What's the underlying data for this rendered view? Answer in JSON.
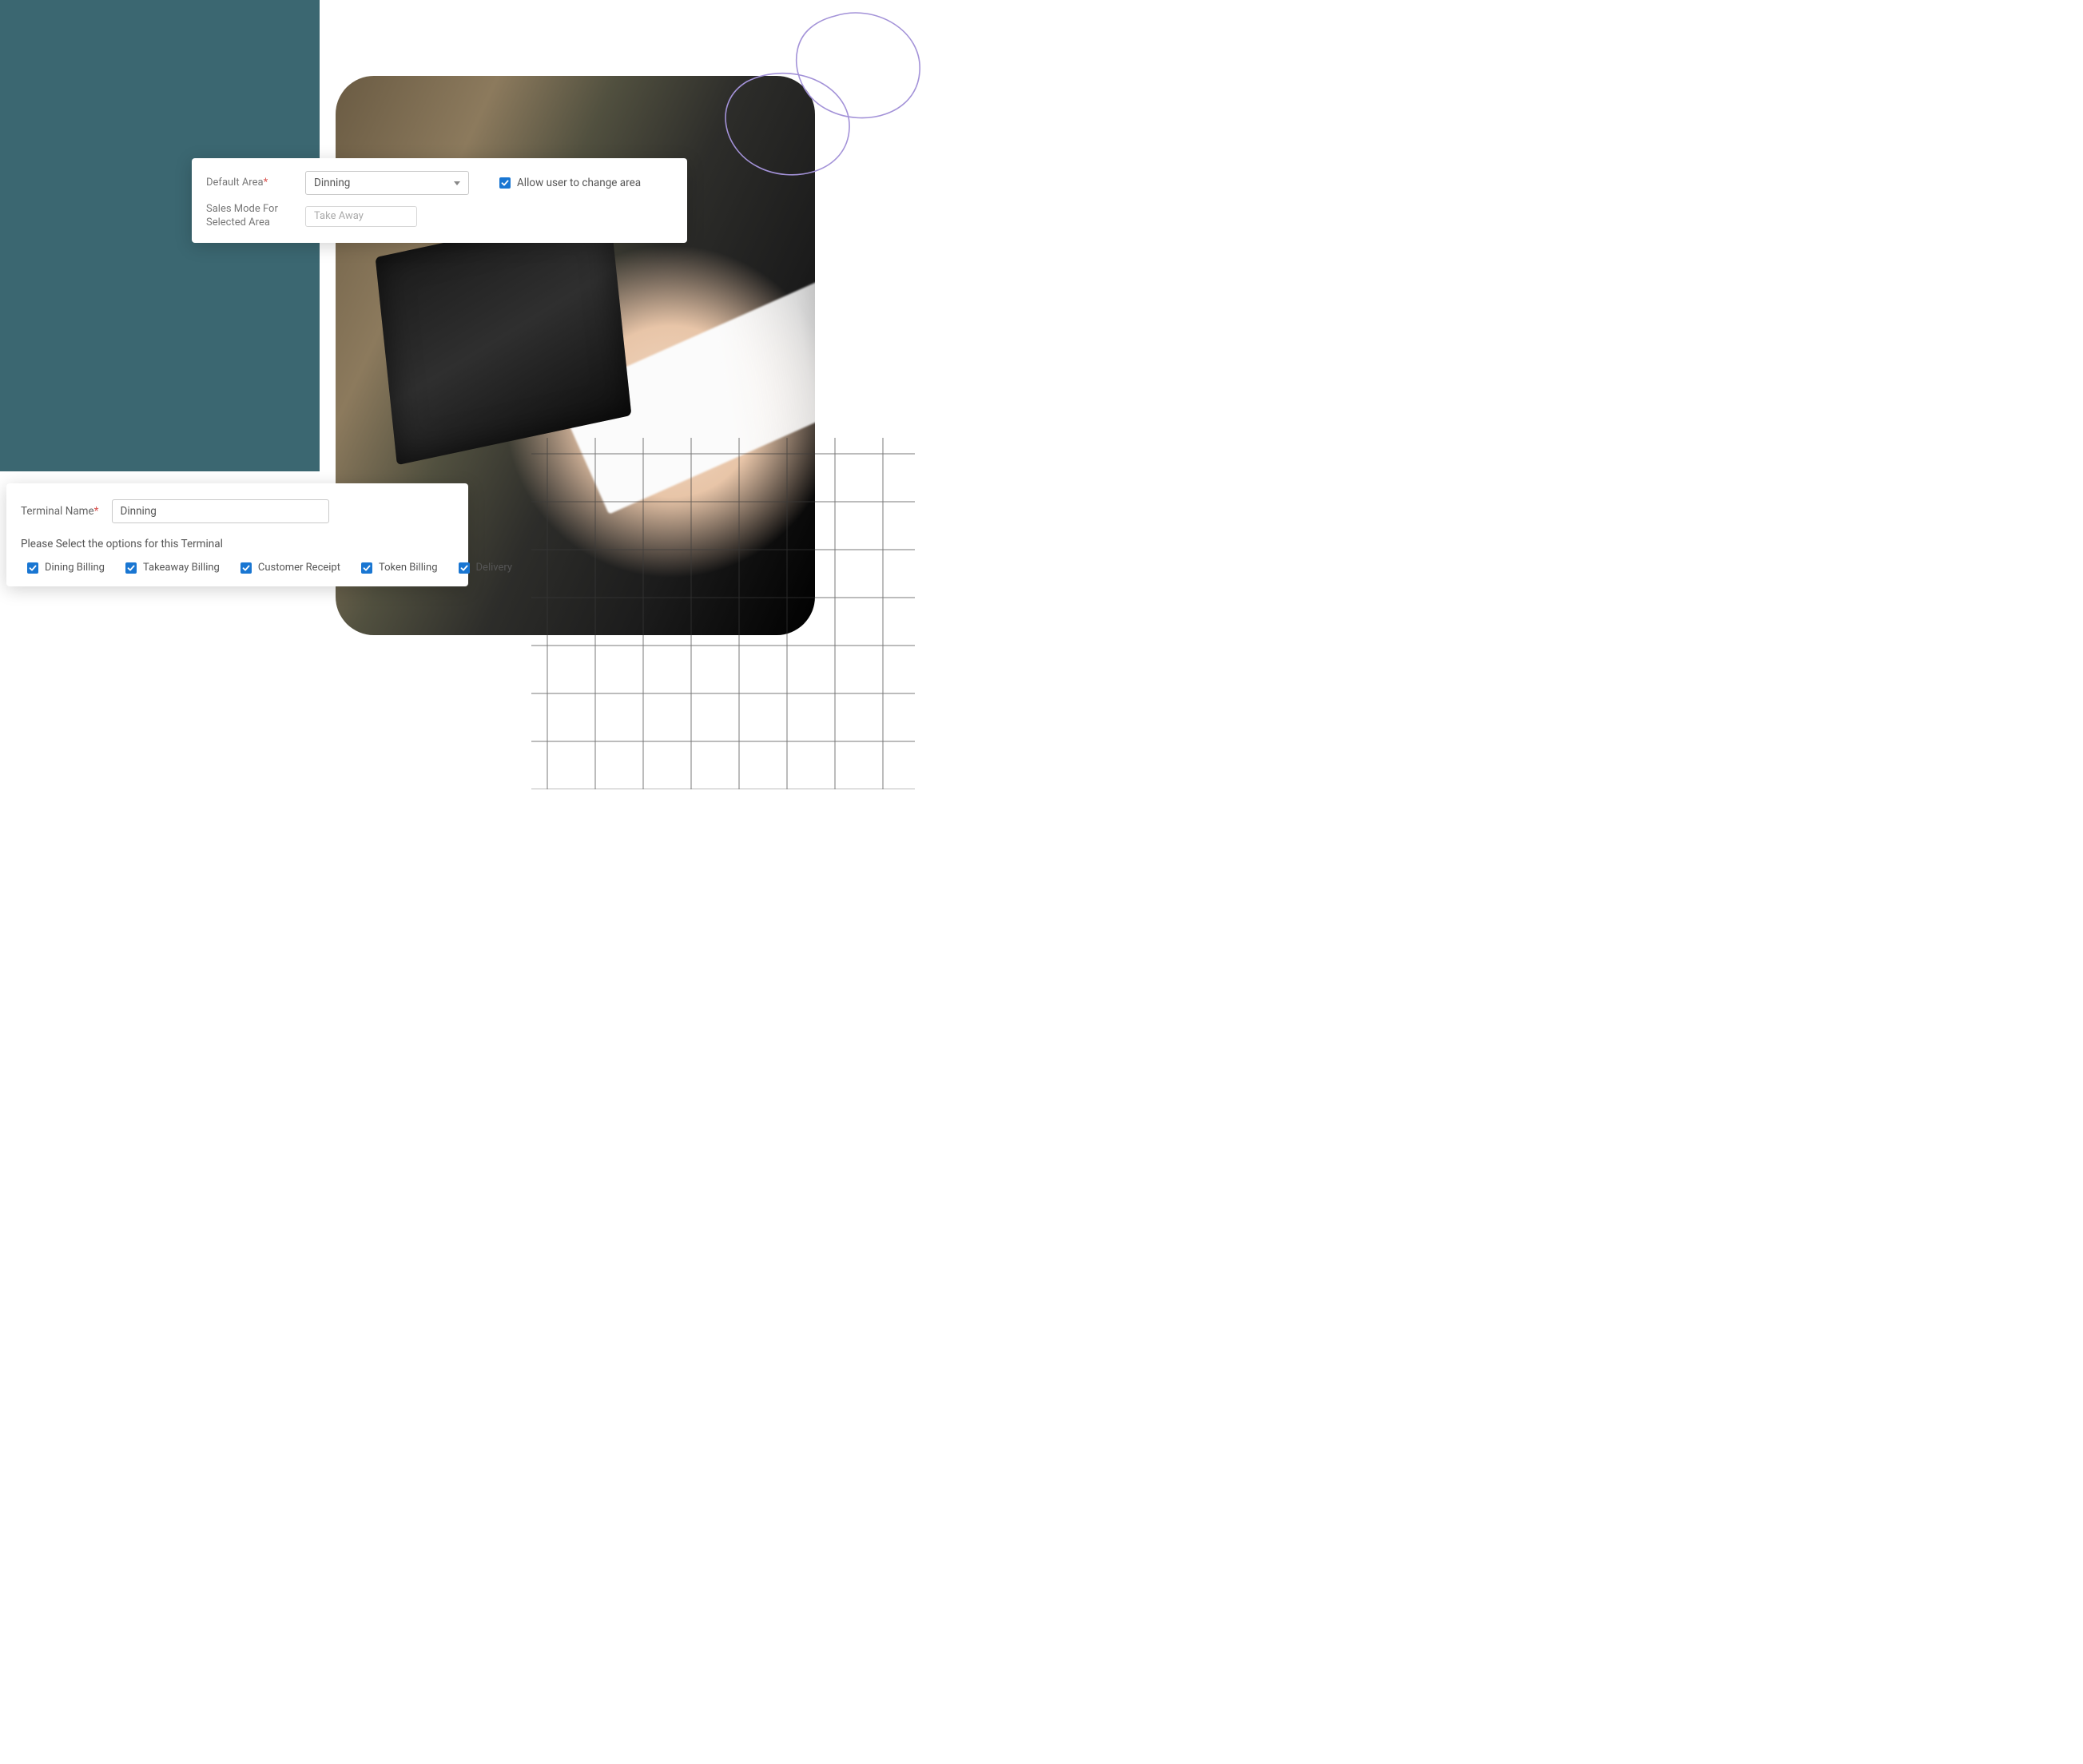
{
  "card1": {
    "default_area_label": "Default Area",
    "default_area_required": "*",
    "default_area_value": "Dinning",
    "allow_change_label": "Allow user to change area",
    "allow_change_checked": true,
    "sales_mode_label": "Sales Mode For Selected Area",
    "sales_mode_placeholder": "Take Away"
  },
  "card2": {
    "terminal_name_label": "Terminal Name",
    "terminal_name_required": "*",
    "terminal_name_value": "Dinning",
    "prompt": "Please Select the options for this Terminal",
    "options": [
      {
        "label": "Dining Billing",
        "checked": true
      },
      {
        "label": "Takeaway Billing",
        "checked": true
      },
      {
        "label": "Customer Receipt",
        "checked": true
      },
      {
        "label": "Token Billing",
        "checked": true
      },
      {
        "label": "Delivery",
        "checked": true
      }
    ]
  }
}
